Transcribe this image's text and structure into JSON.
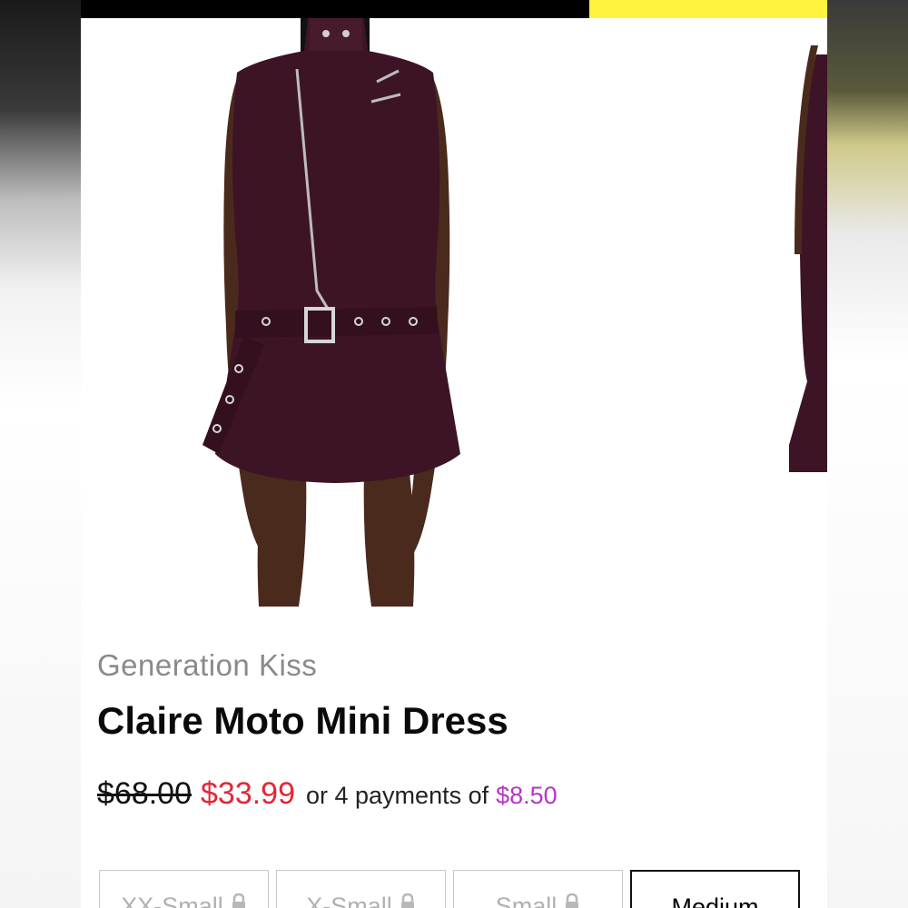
{
  "colors": {
    "promo_dark": "#000000",
    "promo_accent": "#fff23f",
    "sale_price": "#e32636",
    "installment_amount": "#b535c7",
    "dress": "#3d1426"
  },
  "product": {
    "brand": "Generation Kiss",
    "title": "Claire Moto Mini Dress",
    "original_price": "$68.00",
    "sale_price": "$33.99",
    "installment_text": "or 4 payments of",
    "installment_amount": "$8.50"
  },
  "sizes": [
    {
      "label": "XX-Small",
      "locked": true,
      "selected": false
    },
    {
      "label": "X-Small",
      "locked": true,
      "selected": false
    },
    {
      "label": "Small",
      "locked": true,
      "selected": false
    },
    {
      "label": "Medium",
      "locked": false,
      "selected": true
    }
  ]
}
